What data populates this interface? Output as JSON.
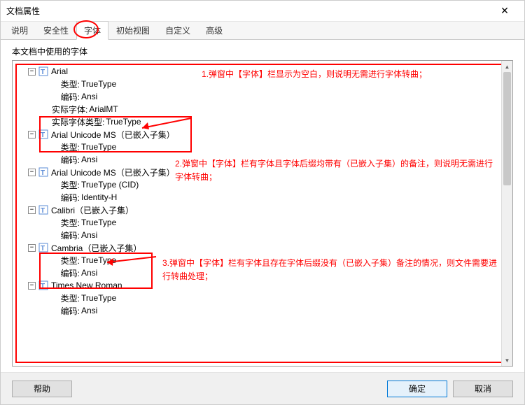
{
  "window": {
    "title": "文档属性"
  },
  "tabs": [
    "说明",
    "安全性",
    "字体",
    "初始视图",
    "自定义",
    "高级"
  ],
  "active_tab_index": 2,
  "group_label": "本文档中使用的字体",
  "fonts": [
    {
      "name": "Arial",
      "props": [
        {
          "k": "类型:",
          "v": "TrueType"
        },
        {
          "k": "编码:",
          "v": "Ansi"
        },
        {
          "k": "实际字体:",
          "v": "ArialMT"
        },
        {
          "k": "实际字体类型:",
          "v": "TrueType"
        }
      ]
    },
    {
      "name": "Arial Unicode MS（已嵌入子集）",
      "props": [
        {
          "k": "类型:",
          "v": "TrueType"
        },
        {
          "k": "编码:",
          "v": "Ansi"
        }
      ]
    },
    {
      "name": "Arial Unicode MS（已嵌入子集）",
      "props": [
        {
          "k": "类型:",
          "v": "TrueType (CID)"
        },
        {
          "k": "编码:",
          "v": "Identity-H"
        }
      ]
    },
    {
      "name": "Calibri（已嵌入子集）",
      "props": [
        {
          "k": "类型:",
          "v": "TrueType"
        },
        {
          "k": "编码:",
          "v": "Ansi"
        }
      ]
    },
    {
      "name": "Cambria（已嵌入子集）",
      "props": [
        {
          "k": "类型:",
          "v": "TrueType"
        },
        {
          "k": "编码:",
          "v": "Ansi"
        }
      ]
    },
    {
      "name": "Times New Roman",
      "props": [
        {
          "k": "类型:",
          "v": "TrueType"
        },
        {
          "k": "编码:",
          "v": "Ansi"
        }
      ]
    }
  ],
  "annotations": {
    "a1": "1.弹窗中【字体】栏显示为空白，则说明无需进行字体转曲；",
    "a2": "2.弹窗中【字体】栏有字体且字体后缀均带有（已嵌入子集）的备注，则说明无需进行字体转曲；",
    "a3": "3.弹窗中【字体】栏有字体且存在字体后缀没有（已嵌入子集）备注的情况，则文件需要进行转曲处理；"
  },
  "buttons": {
    "help": "帮助",
    "ok": "确定",
    "cancel": "取消"
  },
  "icons": {
    "close": "✕",
    "minus": "−",
    "tri_up": "▲",
    "tri_dn": "▼"
  }
}
